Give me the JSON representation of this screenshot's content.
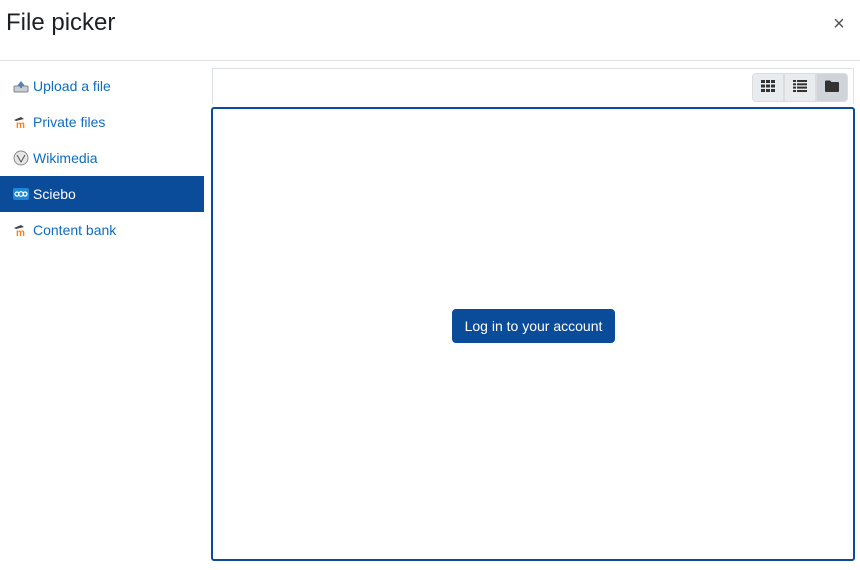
{
  "dialog": {
    "title": "File picker",
    "close_label": "×"
  },
  "sidebar": {
    "items": [
      {
        "label": "Upload a file",
        "icon": "upload-icon",
        "active": false
      },
      {
        "label": "Private files",
        "icon": "moodle-icon",
        "active": false
      },
      {
        "label": "Wikimedia",
        "icon": "wikimedia-icon",
        "active": false
      },
      {
        "label": "Sciebo",
        "icon": "sciebo-icon",
        "active": true
      },
      {
        "label": "Content bank",
        "icon": "moodle-icon",
        "active": false
      }
    ]
  },
  "toolbar": {
    "views": [
      "grid-view-icon",
      "list-view-icon",
      "folder-view-icon"
    ]
  },
  "main": {
    "login_label": "Log in to your account"
  },
  "colors": {
    "accent": "#0a4b9a",
    "link": "#0f6cbf",
    "moodle_orange": "#f98012"
  }
}
